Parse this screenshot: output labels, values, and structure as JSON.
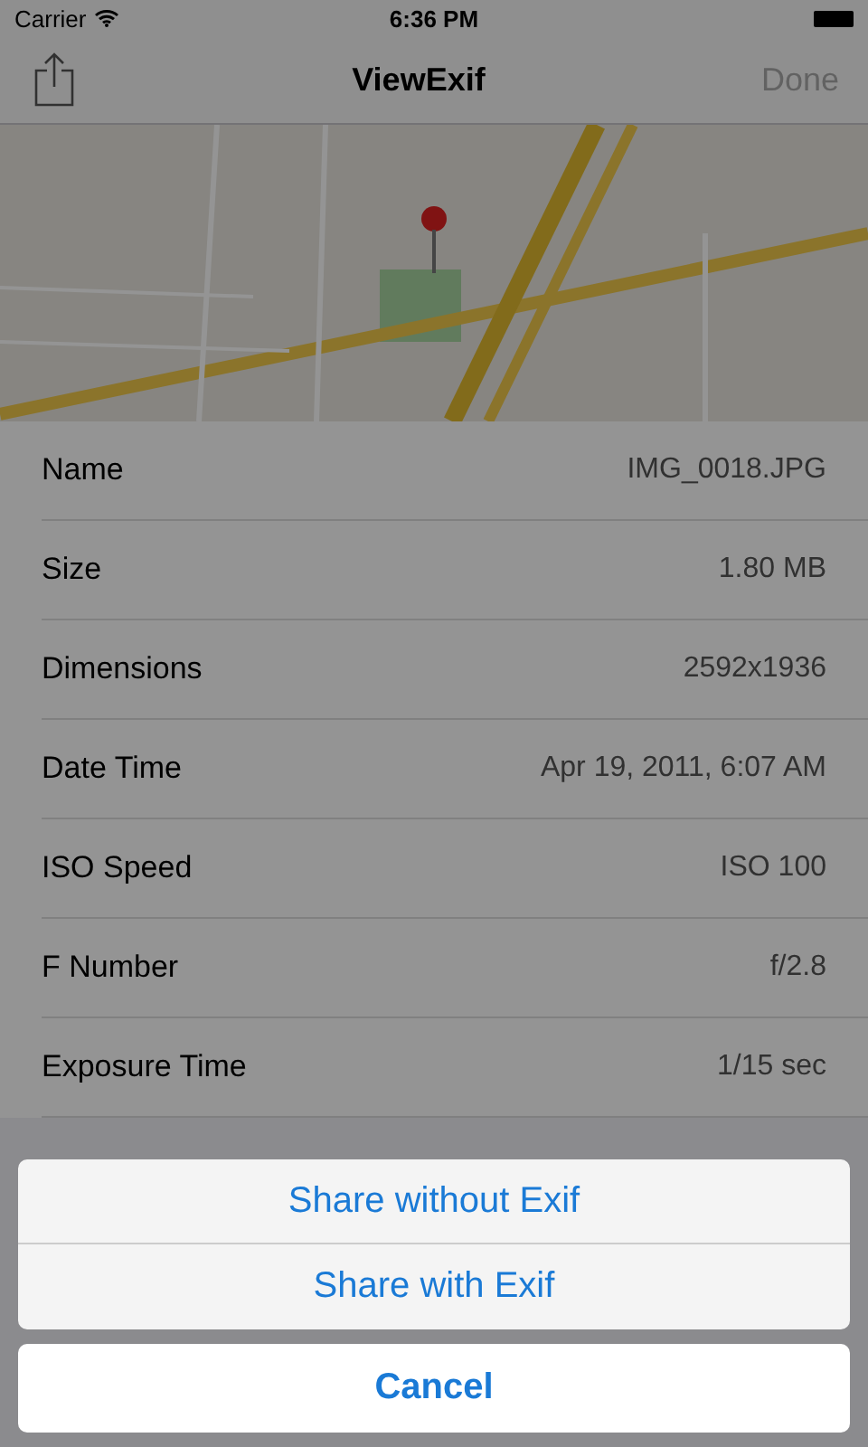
{
  "status_bar": {
    "carrier": "Carrier",
    "time": "6:36 PM"
  },
  "nav_bar": {
    "title": "ViewExif",
    "done": "Done"
  },
  "rows": [
    {
      "label": "Name",
      "value": "IMG_0018.JPG"
    },
    {
      "label": "Size",
      "value": "1.80 MB"
    },
    {
      "label": "Dimensions",
      "value": "2592x1936"
    },
    {
      "label": "Date Time",
      "value": "Apr 19, 2011, 6:07 AM"
    },
    {
      "label": "ISO Speed",
      "value": "ISO 100"
    },
    {
      "label": "F Number",
      "value": "f/2.8"
    },
    {
      "label": "Exposure Time",
      "value": "1/15 sec"
    }
  ],
  "action_sheet": {
    "options": [
      "Share without Exif",
      "Share with Exif"
    ],
    "cancel": "Cancel"
  }
}
